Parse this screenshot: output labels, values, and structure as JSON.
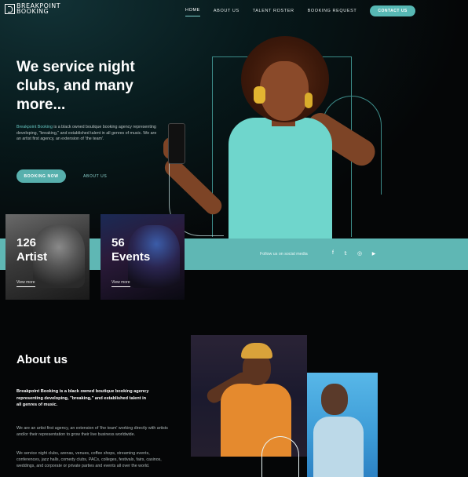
{
  "brand": {
    "logo_line1": "BREAKPOINT",
    "logo_line2": "BOOKING"
  },
  "nav": {
    "items": [
      "HOME",
      "ABOUT US",
      "TALENT ROSTER",
      "BOOKING REQUEST"
    ],
    "cta": "CONTACT US"
  },
  "hero": {
    "title": "We service night clubs, and many more...",
    "desc_brand": "Breakpoint Booking",
    "desc_rest": " is a black owned boutique booking agency representing developing, \"breaking,\" and established talent in all genres of music. We are an artist first agency, an extension of 'the team'.",
    "book_button": "BOOKING NOW",
    "about_link": "ABOUT US"
  },
  "stats": [
    {
      "number": "126",
      "label": "Artist",
      "link": "View more"
    },
    {
      "number": "56",
      "label": "Events",
      "link": "View more"
    }
  ],
  "social": {
    "label": "Follow us on social media",
    "icons": [
      "facebook-icon",
      "twitter-icon",
      "instagram-icon",
      "youtube-icon"
    ],
    "glyphs": [
      "f",
      "𝕥",
      "◎",
      "▶"
    ]
  },
  "about": {
    "title": "About us",
    "intro": "Breakpoint Booking is a black owned boutique booking agency representing developing, \"breaking,\" and established talent in all genres of music.",
    "p1": "We are an artist first agency, an extension of 'the team' working directly with artists and/or their representation to grow their live business worldwide.",
    "p2": "We service night clubs, arenas, venues, coffee shops, streaming events, conferences, jazz halls, comedy clubs, PACs, colleges, festivals, fairs, casinos, weddings, and corporate or private parties and events all over the world."
  },
  "colors": {
    "accent": "#5fb7b4",
    "background": "#050607"
  }
}
